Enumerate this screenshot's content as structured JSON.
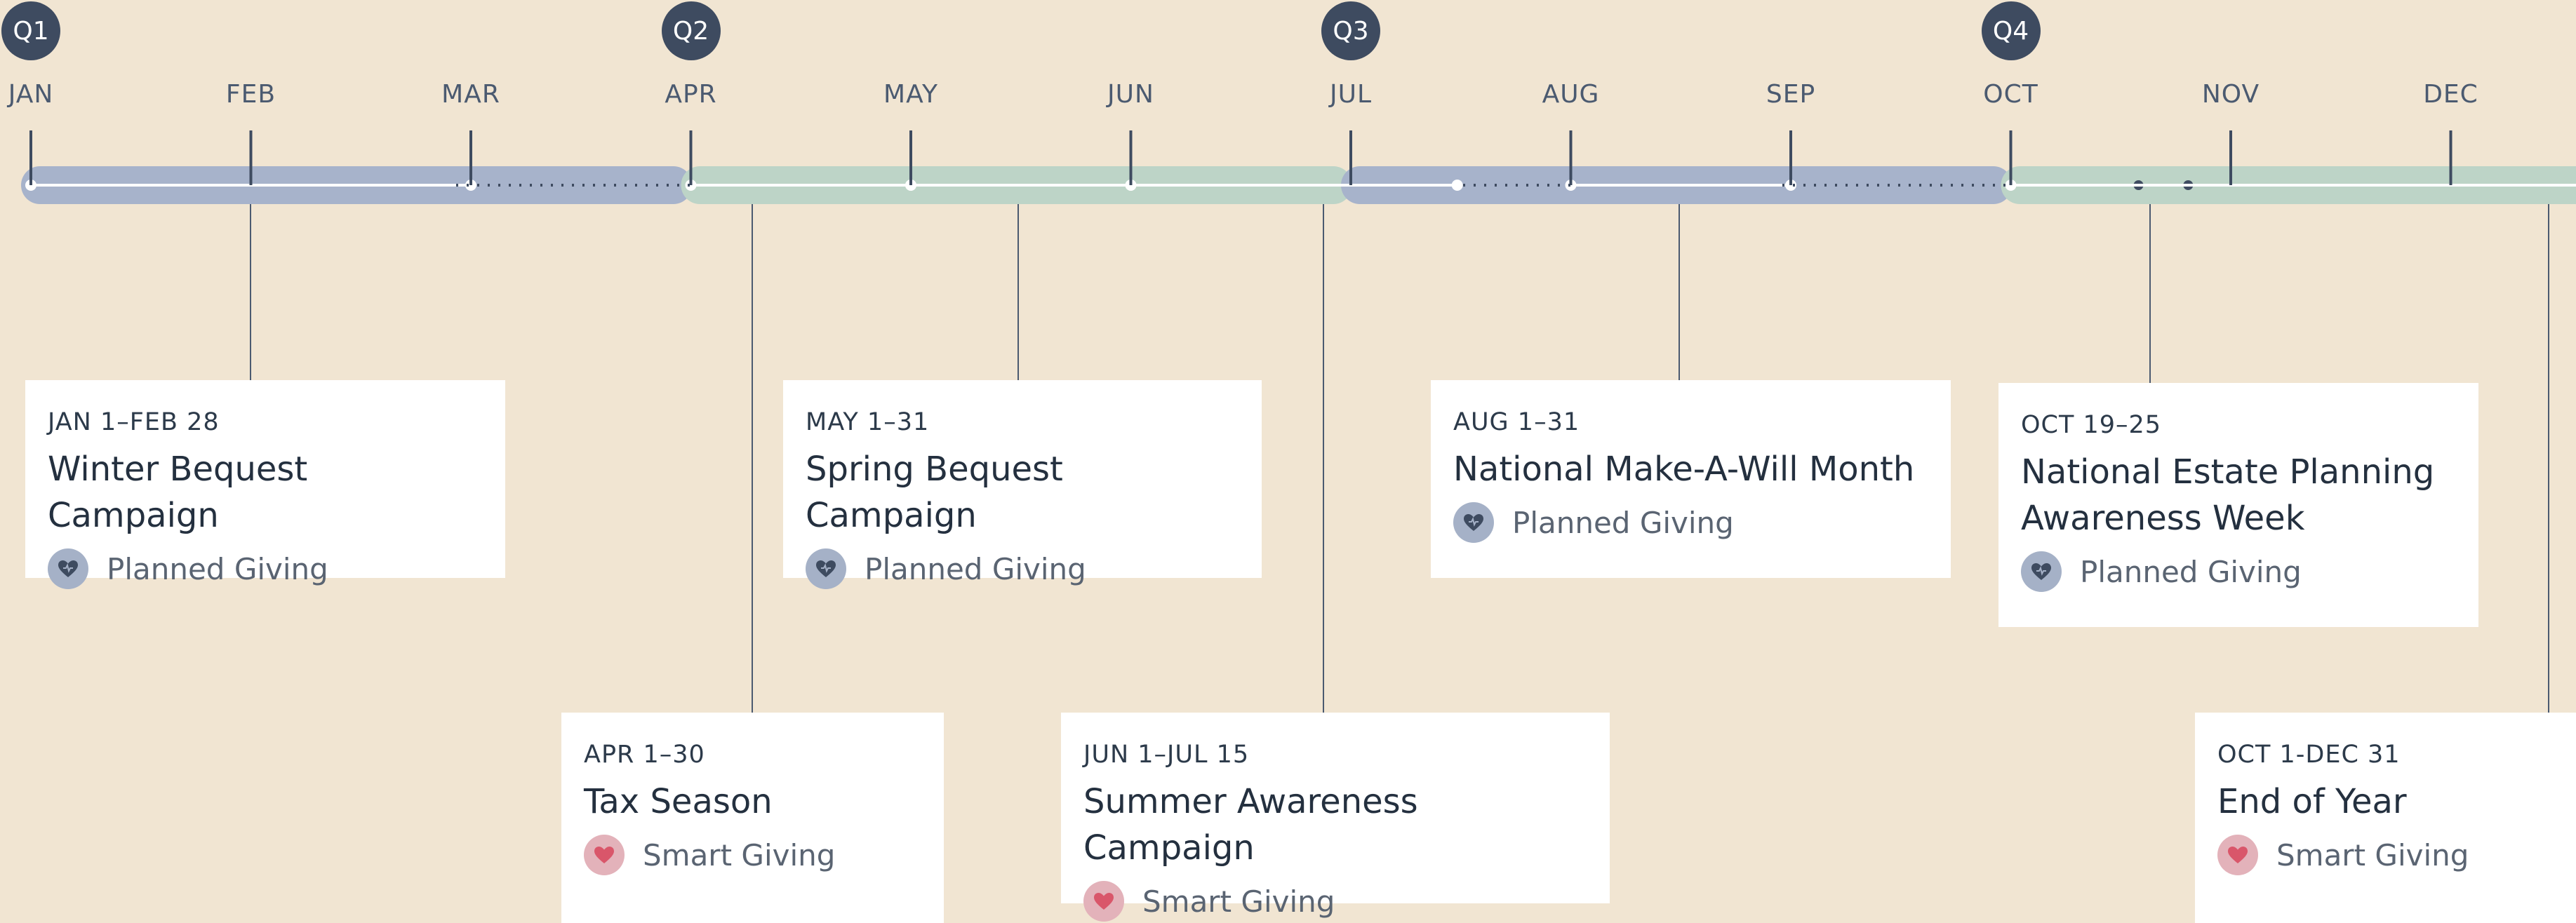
{
  "quarters": [
    {
      "label": "Q1",
      "month_index": 0,
      "color": "#a7b3cb"
    },
    {
      "label": "Q2",
      "month_index": 3,
      "color": "#bdd4c7"
    },
    {
      "label": "Q3",
      "month_index": 6,
      "color": "#a7b3cb"
    },
    {
      "label": "Q4",
      "month_index": 9,
      "color": "#bdd4c7"
    }
  ],
  "months": [
    "JAN",
    "FEB",
    "MAR",
    "APR",
    "MAY",
    "JUN",
    "JUL",
    "AUG",
    "SEP",
    "OCT",
    "NOV",
    "DEC"
  ],
  "colors": {
    "background": "#f1e5d2",
    "badge": "#3e4b60",
    "planned_band": "#a7b3cb",
    "smart_band": "#bdd4c7",
    "planned_icon_bg": "#a5b1c7",
    "planned_heart": "#3e4b60",
    "smart_icon_bg": "#e3b2ba",
    "smart_heart": "#d9566a"
  },
  "events": [
    {
      "date": "JAN 1–FEB 28",
      "title": "Winter Bequest Campaign",
      "category": "Planned Giving",
      "icon": "heart-icon",
      "start": [
        1,
        1
      ],
      "end": [
        2,
        28
      ],
      "row": "top"
    },
    {
      "date": "APR 1–30",
      "title": "Tax Season",
      "category": "Smart Giving",
      "icon": "heart-icon",
      "start": [
        4,
        1
      ],
      "end": [
        4,
        30
      ],
      "row": "bottom"
    },
    {
      "date": "MAY 1–31",
      "title": "Spring Bequest Campaign",
      "category": "Planned Giving",
      "icon": "heart-icon",
      "start": [
        5,
        1
      ],
      "end": [
        5,
        31
      ],
      "row": "top"
    },
    {
      "date": "JUN 1–JUL 15",
      "title": "Summer Awareness Campaign",
      "category": "Smart Giving",
      "icon": "heart-icon",
      "start": [
        6,
        1
      ],
      "end": [
        7,
        15
      ],
      "row": "bottom"
    },
    {
      "date": "AUG 1–31",
      "title": "National Make-A-Will Month",
      "category": "Planned Giving",
      "icon": "heart-icon",
      "start": [
        8,
        1
      ],
      "end": [
        8,
        31
      ],
      "row": "top"
    },
    {
      "date": "OCT 19–25",
      "title": "National Estate Planning Awareness Week",
      "category": "Planned Giving",
      "icon": "heart-icon",
      "start": [
        10,
        19
      ],
      "end": [
        10,
        25
      ],
      "row": "top"
    },
    {
      "date": "OCT 1-DEC 31",
      "title": "End of Year",
      "category": "Smart Giving",
      "icon": "heart-icon",
      "start": [
        10,
        1
      ],
      "end": [
        12,
        31
      ],
      "row": "bottom"
    }
  ]
}
